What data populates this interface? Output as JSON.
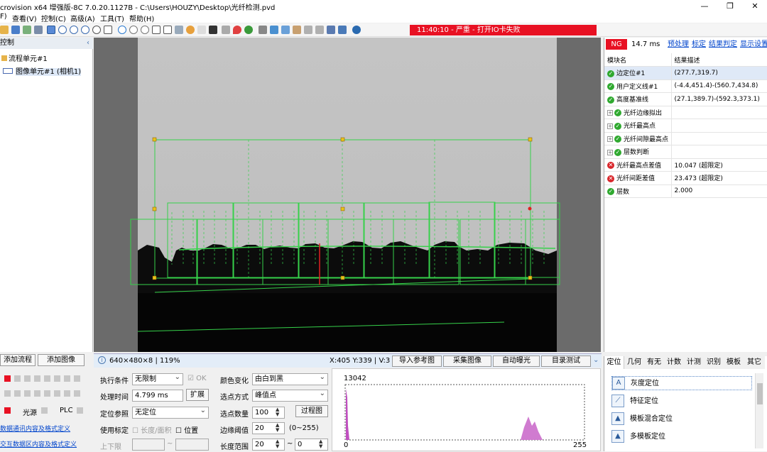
{
  "window": {
    "title": "crovision x64 增强版-8C 7.0.20.1127B - C:\\Users\\HOUZY\\Desktop\\光纤检测.pvd",
    "minimize": "—",
    "maximize": "❐",
    "close": "✕"
  },
  "menu": [
    "F)",
    "查看(V)",
    "控制(C)",
    "高级(A)",
    "工具(T)",
    "帮助(H)"
  ],
  "alarm": "11:40:10 - 严重 - 打开IO卡失败",
  "left_panel": {
    "header": "控制",
    "tree": [
      {
        "label": "流程单元#1"
      },
      {
        "label": "图像单元#1 (相机1)"
      }
    ],
    "add_flow": "添加流程",
    "add_image": "添加图像",
    "light_label": "光源",
    "plc_label": "PLC",
    "link1": "数据通讯内容及格式定义",
    "link2": "交互数据区内容及格式定义"
  },
  "status": {
    "info": "640×480×8 | 119%",
    "coords": "X:405 Y:339 | V:3",
    "buttons": [
      "导入参考图",
      "采集图像",
      "自动曝光",
      "目录测试"
    ]
  },
  "result_panel": {
    "status": "NG",
    "time": "14.7 ms",
    "links": [
      "预处理",
      "标定",
      "结果判定",
      "显示设置"
    ],
    "columns": [
      "模块名",
      "结果描述"
    ],
    "rows": [
      {
        "name": "边定位#1",
        "desc": "(277.7,319.7)",
        "state": "ok",
        "expand": false
      },
      {
        "name": "用户定义线#1",
        "desc": "(-4.4,451.4)-(560.7,434.8)",
        "state": "ok",
        "expand": false
      },
      {
        "name": "高度基准线",
        "desc": "(27.1,389.7)-(592.3,373.1)",
        "state": "ok",
        "expand": false
      },
      {
        "name": "光纤边缘拟出",
        "desc": "",
        "state": "ok",
        "expand": true
      },
      {
        "name": "光纤最高点",
        "desc": "",
        "state": "ok",
        "expand": true
      },
      {
        "name": "光纤间隙最高点",
        "desc": "",
        "state": "ok",
        "expand": true
      },
      {
        "name": "层数判断",
        "desc": "",
        "state": "ok",
        "expand": true
      },
      {
        "name": "光纤最高点差值",
        "desc": "10.047 (超限定)",
        "state": "ng",
        "expand": false
      },
      {
        "name": "光纤间距差值",
        "desc": "23.473 (超限定)",
        "state": "ng",
        "expand": false
      },
      {
        "name": "层数",
        "desc": "2.000",
        "state": "ok",
        "expand": false
      }
    ]
  },
  "params": {
    "exec_cond_label": "执行条件",
    "exec_cond": "无限制",
    "ok_label": "OK",
    "proc_time_label": "处理时间",
    "proc_time": "4.799 ms",
    "expand_btn": "扩展",
    "pos_ref_label": "定位参照",
    "pos_ref": "无定位",
    "use_calib_label": "使用标定",
    "len_area": "长度/面积",
    "position": "位置",
    "range_label": "上下限",
    "tilde": "~",
    "color_change_label": "颜色变化",
    "color_change": "由白到黑",
    "pick_method_label": "选点方式",
    "pick_method": "峰值点",
    "pick_count_label": "选点数量",
    "pick_count": "100",
    "filter_btn": "过程图",
    "edge_thresh_label": "边缘阈值",
    "edge_thresh": "20",
    "edge_range": "(0~255)",
    "len_range_label": "长度范围",
    "len_min": "20",
    "len_max": "0"
  },
  "histogram": {
    "peak": "13042",
    "x_min": "0",
    "x_max": "255"
  },
  "tool_panel": {
    "tabs": [
      "定位",
      "几何",
      "有无",
      "计数",
      "计测",
      "识别",
      "模板",
      "其它"
    ],
    "items": [
      "灰度定位",
      "特征定位",
      "模板混合定位",
      "多模板定位"
    ]
  },
  "colors": {
    "alarm_red": "#e81123",
    "ng_red": "#d9262b",
    "ok_green": "#2fa92f",
    "overlay_green": "#36d14a",
    "anchor_yellow": "#e8c21a",
    "histo_purple": "#d07bd0"
  }
}
